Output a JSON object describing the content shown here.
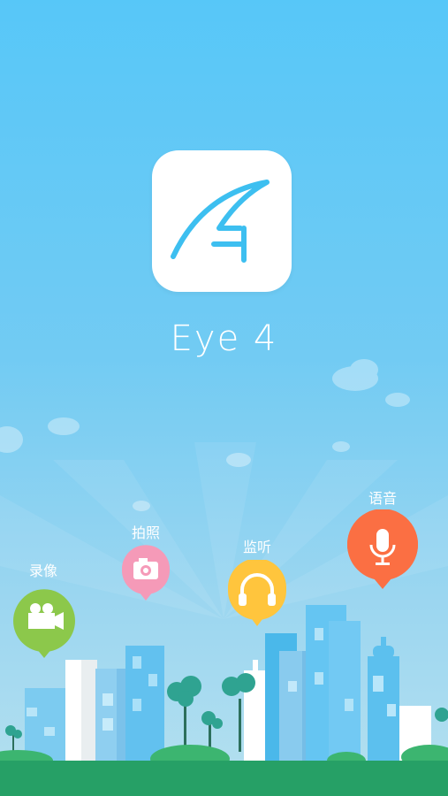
{
  "app": {
    "name": "Eye 4",
    "logo_icon": "eye4-logo-icon"
  },
  "features": [
    {
      "id": "record",
      "label": "录像",
      "icon": "video-camera-icon",
      "color": "#8cc84b"
    },
    {
      "id": "photo",
      "label": "拍照",
      "icon": "camera-icon",
      "color": "#f59ab8"
    },
    {
      "id": "listen",
      "label": "监听",
      "icon": "headphones-icon",
      "color": "#ffc53d"
    },
    {
      "id": "voice",
      "label": "语音",
      "icon": "microphone-icon",
      "color": "#fb6f43"
    }
  ],
  "colors": {
    "sky_top": "#57c7f8",
    "logo_accent": "#3dbff0",
    "ground": "#26a066"
  }
}
